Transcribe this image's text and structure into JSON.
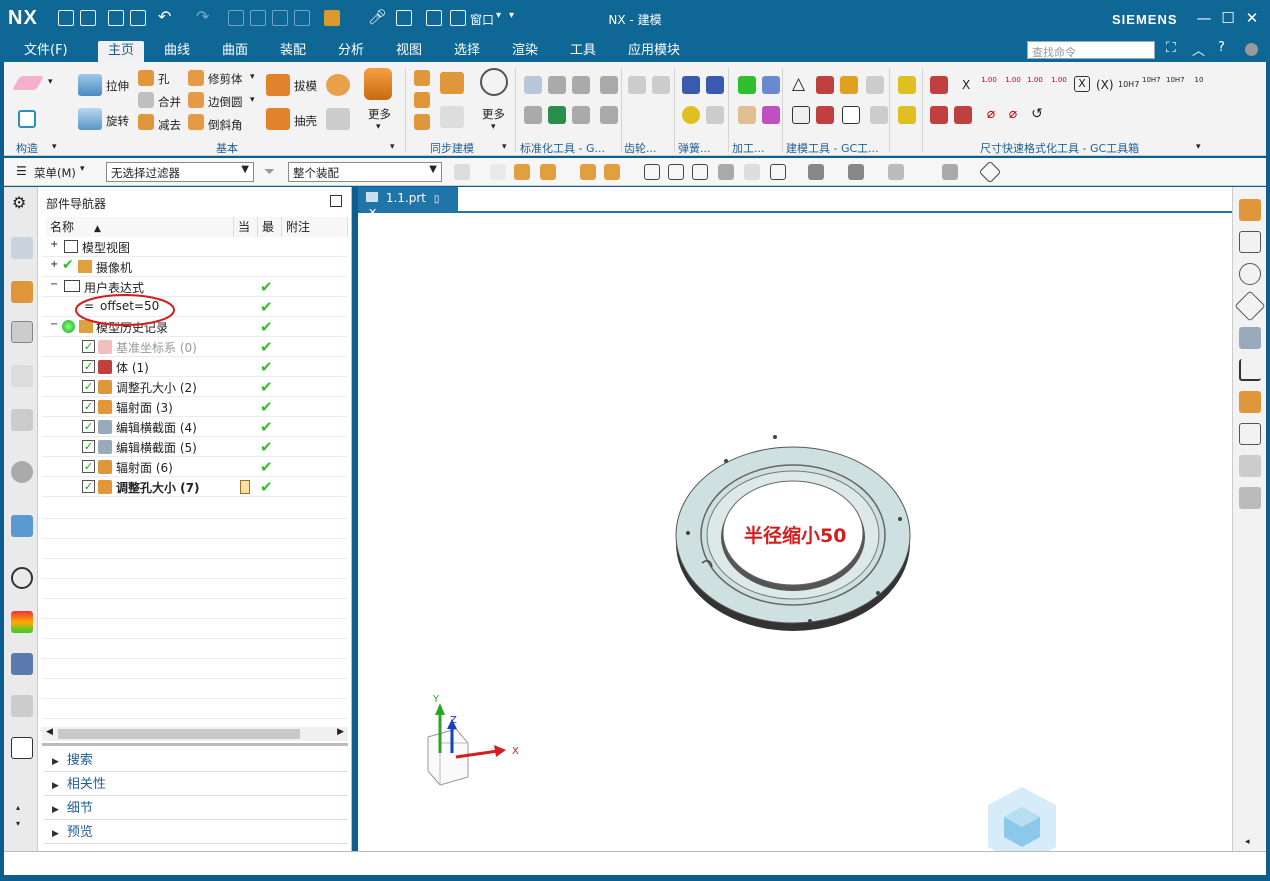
{
  "app": {
    "logo": "NX",
    "title": "NX - 建模",
    "brand": "SIEMENS",
    "window_menu": "窗口"
  },
  "menu_tabs": [
    "文件(F)",
    "主页",
    "曲线",
    "曲面",
    "装配",
    "分析",
    "视图",
    "选择",
    "渲染",
    "工具",
    "应用模块"
  ],
  "active_tab": "主页",
  "search": {
    "placeholder": "查找命令"
  },
  "ribbon": {
    "buttons": {
      "extrude": "拉伸",
      "revolve": "旋转",
      "hole": "孔",
      "unite": "合并",
      "subtract": "减去",
      "trim": "修剪体",
      "edge_blend": "边倒圆",
      "chamfer": "倒斜角",
      "draft": "拔模",
      "shell": "抽壳",
      "more1": "更多",
      "more2": "更多"
    },
    "groups": [
      "构造",
      "基本",
      "同步建模",
      "标准化工具 - G...",
      "齿轮...",
      "弹簧...",
      "加工...",
      "建模工具 - GC工...",
      "尺寸快速格式化工具 - GC工具箱"
    ],
    "dim_texts": [
      "X",
      "(X)",
      "10H7"
    ]
  },
  "toolbar2": {
    "menu": "菜单(M)",
    "filter": "无选择过滤器",
    "assembly": "整个装配"
  },
  "navigator": {
    "title": "部件导航器",
    "columns": [
      "名称",
      "当",
      "最",
      "附注"
    ],
    "rows": [
      {
        "label": "模型视图",
        "check": ""
      },
      {
        "label": "摄像机",
        "check": ""
      },
      {
        "label": "用户表达式",
        "check": "✔"
      },
      {
        "label": "offset=50",
        "check": "✔"
      },
      {
        "label": "模型历史记录",
        "check": "✔"
      },
      {
        "label": "基准坐标系 (0)",
        "check": "✔"
      },
      {
        "label": "体 (1)",
        "check": "✔"
      },
      {
        "label": "调整孔大小 (2)",
        "check": "✔"
      },
      {
        "label": "辐射面 (3)",
        "check": "✔"
      },
      {
        "label": "编辑横截面 (4)",
        "check": "✔"
      },
      {
        "label": "编辑横截面 (5)",
        "check": "✔"
      },
      {
        "label": "辐射面 (6)",
        "check": "✔"
      },
      {
        "label": "调整孔大小 (7)",
        "check": "✔"
      }
    ],
    "sections": [
      "搜索",
      "相关性",
      "细节",
      "预览"
    ]
  },
  "viewport": {
    "tab": "1.1.prt",
    "annotation": "半径缩小50",
    "axes": {
      "x": "X",
      "y": "Y",
      "z": "Z"
    }
  },
  "colors": {
    "titlebar": "#0f6796",
    "accent_red": "#d21f1f",
    "check_green": "#2fbf2f",
    "part": "#cfe0e0"
  }
}
